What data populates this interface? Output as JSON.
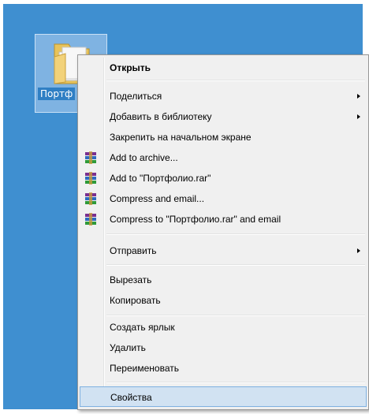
{
  "folder": {
    "label": "Портф"
  },
  "menu": {
    "open": "Открыть",
    "share": "Поделиться",
    "add_to_library": "Добавить в библиотеку",
    "pin_to_start": "Закрепить на начальном экране",
    "add_to_archive": "Add to archive...",
    "add_to_rar": "Add to \"Портфолио.rar\"",
    "compress_email": "Compress and email...",
    "compress_rar_email": "Compress to \"Портфолио.rar\" and email",
    "send_to": "Отправить",
    "cut": "Вырезать",
    "copy": "Копировать",
    "create_shortcut": "Создать ярлык",
    "delete": "Удалить",
    "rename": "Переименовать",
    "properties": "Свойства"
  }
}
